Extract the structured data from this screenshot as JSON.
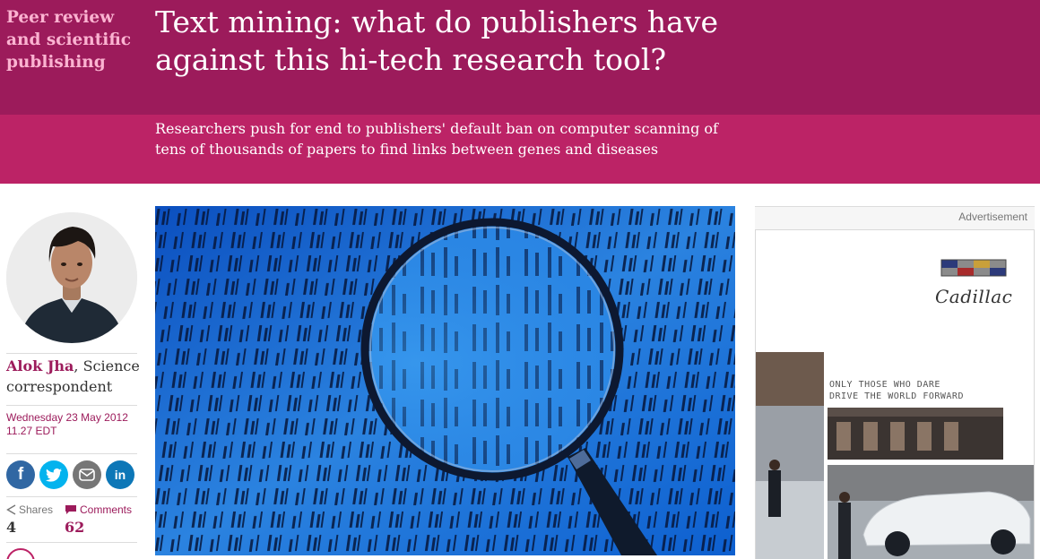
{
  "section": {
    "label": "Peer review and scientific publishing"
  },
  "article": {
    "headline": "Text mining: what do publishers have against this hi-tech research tool?",
    "standfirst": "Researchers push for end to publishers' default ban on computer scanning of tens of thousands of papers to find links between genes and diseases"
  },
  "byline": {
    "author": "Alok Jha",
    "role": ", Science correspondent",
    "date": "Wednesday 23 May 2012 11.27 EDT"
  },
  "share": {
    "buttons": [
      {
        "icon": "facebook-icon",
        "label": "f"
      },
      {
        "icon": "twitter-icon",
        "label": ""
      },
      {
        "icon": "email-icon",
        "label": ""
      },
      {
        "icon": "linkedin-icon",
        "label": "in"
      }
    ],
    "shares_label": "Shares",
    "shares_count": "4",
    "comments_label": "Comments",
    "comments_count": "62"
  },
  "advertisement": {
    "label": "Advertisement",
    "brand": "Cadillac",
    "tagline_line1": "ONLY THOSE WHO DARE",
    "tagline_line2": "DRIVE THE WORLD FORWARD"
  },
  "colors": {
    "headline_band": "#9c1b5b",
    "standfirst_band": "#bc2366",
    "section_label": "#fbb3d1",
    "byline_accent": "#9c1b5b"
  }
}
